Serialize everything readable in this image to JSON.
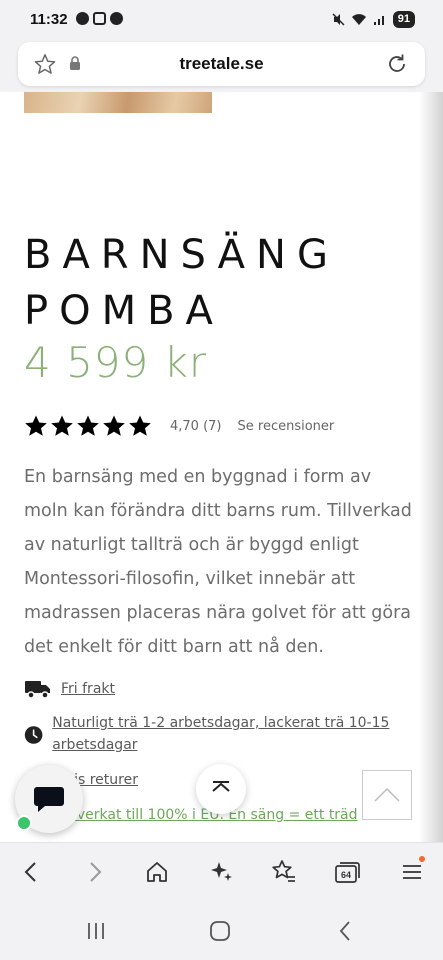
{
  "status_bar": {
    "time": "11:32",
    "battery": "91"
  },
  "browser": {
    "url": "treetale.se",
    "tab_count": "64"
  },
  "product": {
    "title_line1": "BARNSÄNG",
    "title_line2": "POMBA",
    "price": "4 599 kr",
    "rating": {
      "stars": 5,
      "value_text": "4,70 (7)",
      "reviews_link": "Se recensioner"
    },
    "description": "En barnsäng med en byggnad i form av moln kan förändra ditt barns rum. Tillverkad av naturligt tallträ och är byggd enligt Montessori-filosofin, vilket innebär att madrassen placeras nära golvet för att göra det enkelt för ditt barn att nå den.",
    "info": {
      "shipping": "Fri frakt",
      "delivery": "Naturligt trä 1-2 arbetsdagar, lackerat trä 10-15 arbetsdagar",
      "returns": "atis returer",
      "eco": "lverkat till 100% i EU. En säng = ett träd"
    }
  },
  "colors": {
    "price_green": "#8bb078",
    "eco_green": "#6da85a",
    "online_green": "#3bc56a",
    "menu_dot": "#f06a33"
  },
  "icons": [
    "star-icon",
    "lock-icon",
    "reload-icon",
    "truck-icon",
    "clock-icon",
    "chat-icon",
    "chevron-up-icon",
    "back-icon",
    "forward-icon",
    "home-icon",
    "sparkle-icon",
    "favorites-icon",
    "tabs-icon",
    "menu-icon",
    "recents-icon",
    "nav-home-icon",
    "nav-back-icon"
  ]
}
